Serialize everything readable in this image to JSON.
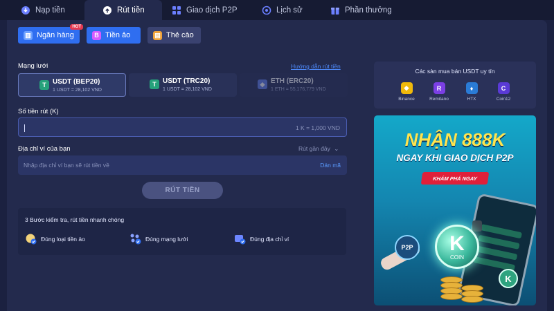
{
  "tabs": [
    {
      "label": "Nạp tiền",
      "icon": "deposit-icon"
    },
    {
      "label": "Rút tiền",
      "icon": "withdraw-icon",
      "active": true
    },
    {
      "label": "Giao dịch P2P",
      "icon": "p2p-icon"
    },
    {
      "label": "Lịch sử",
      "icon": "history-icon"
    },
    {
      "label": "Phần thưởng",
      "icon": "gift-icon"
    }
  ],
  "subtabs": [
    {
      "label": "Ngân hàng",
      "icon": "bank-icon",
      "badge": "HOT",
      "color": "#2f6ef0"
    },
    {
      "label": "Tiền ảo",
      "icon": "bitcoin-icon",
      "color": "#2f6ef0",
      "active": true
    },
    {
      "label": "Thẻ cào",
      "icon": "card-icon",
      "color": "#3a4270"
    }
  ],
  "network": {
    "label": "Mạng lưới",
    "guide_link": "Hướng dẫn rút tiền",
    "options": [
      {
        "name": "USDT (BEP20)",
        "rate": "1 USDT = 28,102 VND",
        "selected": true,
        "icon": "tether-icon"
      },
      {
        "name": "USDT (TRC20)",
        "rate": "1 USDT = 28,102 VND",
        "selected": false,
        "icon": "tether-icon"
      },
      {
        "name": "ETH (ERC20)",
        "rate": "1 ETH = 55,176,779 VND",
        "selected": false,
        "disabled": true,
        "icon": "ethereum-icon"
      }
    ]
  },
  "amount": {
    "label": "Số tiền rút (K)",
    "value": "",
    "hint": "1 K = 1,000 VND"
  },
  "wallet": {
    "label": "Địa chỉ ví của bạn",
    "recent": "Rút gần đây",
    "placeholder": "Nhập địa chỉ ví bạn sẽ rút tiền về",
    "paste": "Dán mã"
  },
  "submit_label": "RÚT TIỀN",
  "steps": {
    "title": "3 Bước kiểm tra, rút tiền nhanh chóng",
    "items": [
      {
        "label": "Đúng loại tiền ảo",
        "icon": "coin-check-icon"
      },
      {
        "label": "Đúng mạng lưới",
        "icon": "network-check-icon"
      },
      {
        "label": "Đúng địa chỉ ví",
        "icon": "wallet-check-icon"
      }
    ]
  },
  "exchanges": {
    "title": "Các sàn mua bán USDT uy tín",
    "items": [
      {
        "name": "Binance",
        "color": "#f0b90b",
        "glyph": "◆"
      },
      {
        "name": "Remitano",
        "color": "#7b3fe4",
        "glyph": "R"
      },
      {
        "name": "HTX",
        "color": "#2a7bd6",
        "glyph": "♦"
      },
      {
        "name": "Coin12",
        "color": "#5a3ad6",
        "glyph": "C"
      }
    ]
  },
  "banner": {
    "headline": "NHẬN 888K",
    "subline": "NGAY KHI GIAO DỊCH P2P",
    "cta": "KHÁM PHÁ NGAY",
    "coin_letter": "K",
    "coin_text": "COIN",
    "p2p_badge": "P2P"
  },
  "colors": {
    "background": "#1b2140",
    "panel": "#232a4d",
    "accent": "#2f6ef0",
    "link": "#4f8cff",
    "tether": "#26a17b",
    "ethereum": "#627eea"
  }
}
